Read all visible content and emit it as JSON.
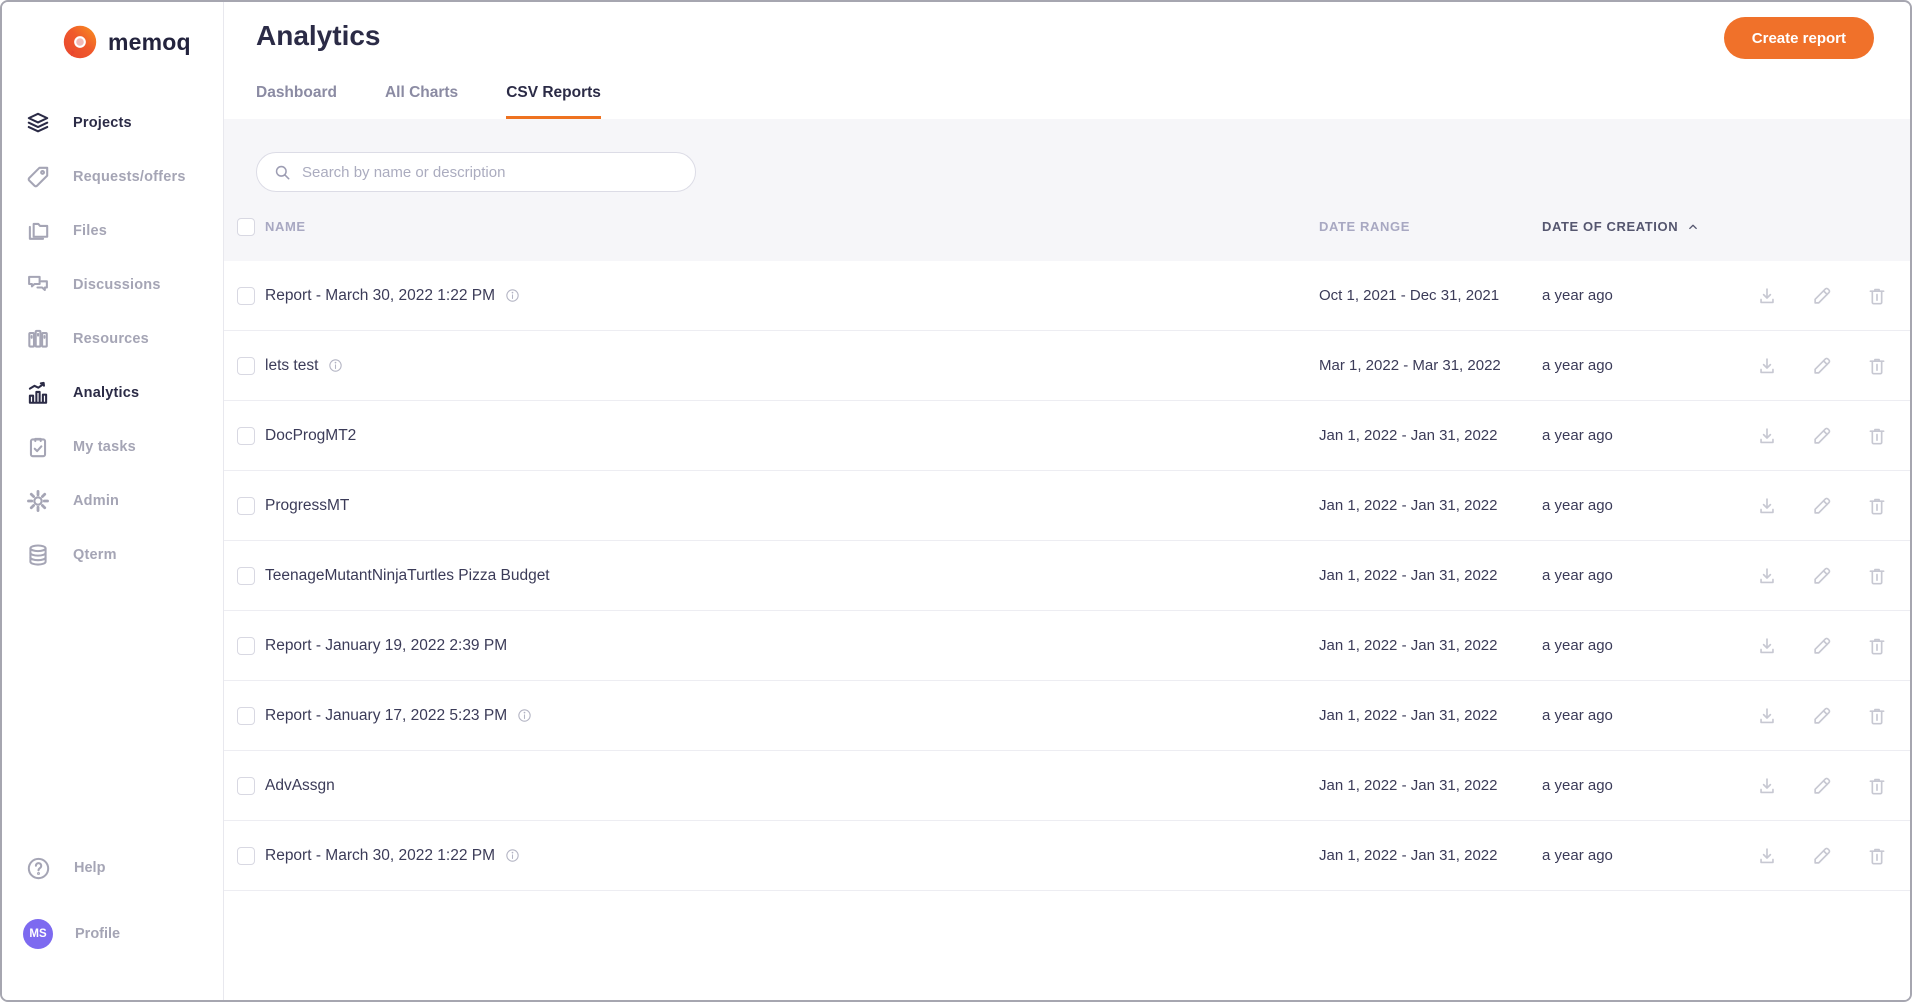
{
  "brand": {
    "name": "memoq"
  },
  "sidebar": {
    "items": [
      {
        "label": "Projects",
        "icon": "layers-icon",
        "active": true
      },
      {
        "label": "Requests/offers",
        "icon": "tag-icon",
        "active": false
      },
      {
        "label": "Files",
        "icon": "folders-icon",
        "active": false
      },
      {
        "label": "Discussions",
        "icon": "chat-icon",
        "active": false
      },
      {
        "label": "Resources",
        "icon": "books-icon",
        "active": false
      },
      {
        "label": "Analytics",
        "icon": "bar-chart-icon",
        "active": true
      },
      {
        "label": "My tasks",
        "icon": "clipboard-icon",
        "active": false
      },
      {
        "label": "Admin",
        "icon": "gear-icon",
        "active": false
      },
      {
        "label": "Qterm",
        "icon": "database-icon",
        "active": false
      }
    ],
    "footer": {
      "help_label": "Help",
      "profile_label": "Profile",
      "avatar_initials": "MS"
    }
  },
  "header": {
    "title": "Analytics",
    "create_button": "Create report"
  },
  "tabs": [
    {
      "label": "Dashboard",
      "active": false
    },
    {
      "label": "All Charts",
      "active": false
    },
    {
      "label": "CSV Reports",
      "active": true
    }
  ],
  "search": {
    "placeholder": "Search by name or description"
  },
  "table": {
    "header": {
      "name": "NAME",
      "date_range": "DATE RANGE",
      "date_of_creation": "DATE OF CREATION"
    },
    "sort": {
      "column": "DATE OF CREATION",
      "direction": "asc"
    },
    "row_actions": [
      "download-icon",
      "edit-icon",
      "delete-icon"
    ],
    "rows": [
      {
        "name": "Report - March 30, 2022 1:22 PM",
        "has_info": true,
        "date_range": "Oct 1, 2021 - Dec 31, 2021",
        "created": "a year ago"
      },
      {
        "name": "lets test",
        "has_info": true,
        "date_range": "Mar 1, 2022 - Mar 31, 2022",
        "created": "a year ago"
      },
      {
        "name": "DocProgMT2",
        "has_info": false,
        "date_range": "Jan 1, 2022 - Jan 31, 2022",
        "created": "a year ago"
      },
      {
        "name": "ProgressMT",
        "has_info": false,
        "date_range": "Jan 1, 2022 - Jan 31, 2022",
        "created": "a year ago"
      },
      {
        "name": "TeenageMutantNinjaTurtles Pizza Budget",
        "has_info": false,
        "date_range": "Jan 1, 2022 - Jan 31, 2022",
        "created": "a year ago"
      },
      {
        "name": "Report - January 19, 2022 2:39 PM",
        "has_info": false,
        "date_range": "Jan 1, 2022 - Jan 31, 2022",
        "created": "a year ago"
      },
      {
        "name": "Report - January 17, 2022 5:23 PM",
        "has_info": true,
        "date_range": "Jan 1, 2022 - Jan 31, 2022",
        "created": "a year ago"
      },
      {
        "name": "AdvAssgn",
        "has_info": false,
        "date_range": "Jan 1, 2022 - Jan 31, 2022",
        "created": "a year ago"
      },
      {
        "name": "Report - March 30, 2022 1:22 PM",
        "has_info": true,
        "date_range": "Jan 1, 2022 - Jan 31, 2022",
        "created": "a year ago"
      }
    ]
  },
  "colors": {
    "accent_orange": "#f0712a",
    "tab_underline": "#ee7220",
    "dark_text": "#2b2b46",
    "inactive_gray": "#a5a5b5",
    "avatar_purple": "#7d6af0",
    "content_background": "#f6f6f9"
  }
}
